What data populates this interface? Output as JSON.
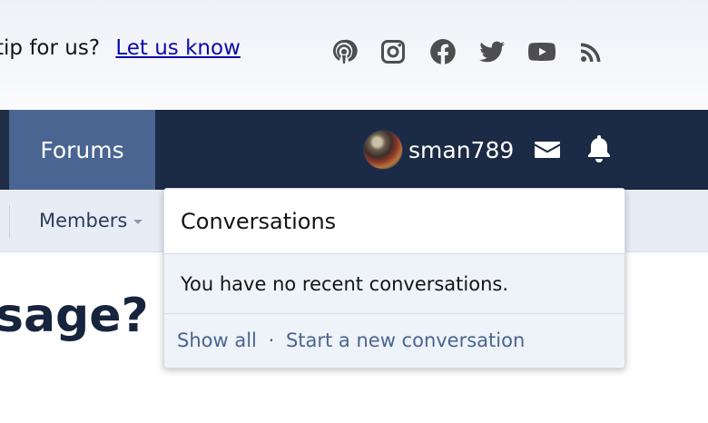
{
  "top_bar": {
    "tip_text": "tip for us?",
    "tip_link": "Let us know",
    "social_icons": [
      "podcast-icon",
      "instagram-icon",
      "facebook-icon",
      "twitter-icon",
      "youtube-icon",
      "rss-icon"
    ]
  },
  "nav": {
    "forums_label": "Forums",
    "username": "sman789"
  },
  "subnav": {
    "members_label": "Members"
  },
  "main": {
    "title_fragment": "sage?"
  },
  "conversations_dropdown": {
    "title": "Conversations",
    "empty_message": "You have no recent conversations.",
    "show_all": "Show all",
    "separator": "·",
    "start_new": "Start a new conversation"
  },
  "colors": {
    "nav_bg": "#1b2a45",
    "nav_active": "#4a6591",
    "link": "#4a6591",
    "subnav_bg": "#e8edf5"
  }
}
